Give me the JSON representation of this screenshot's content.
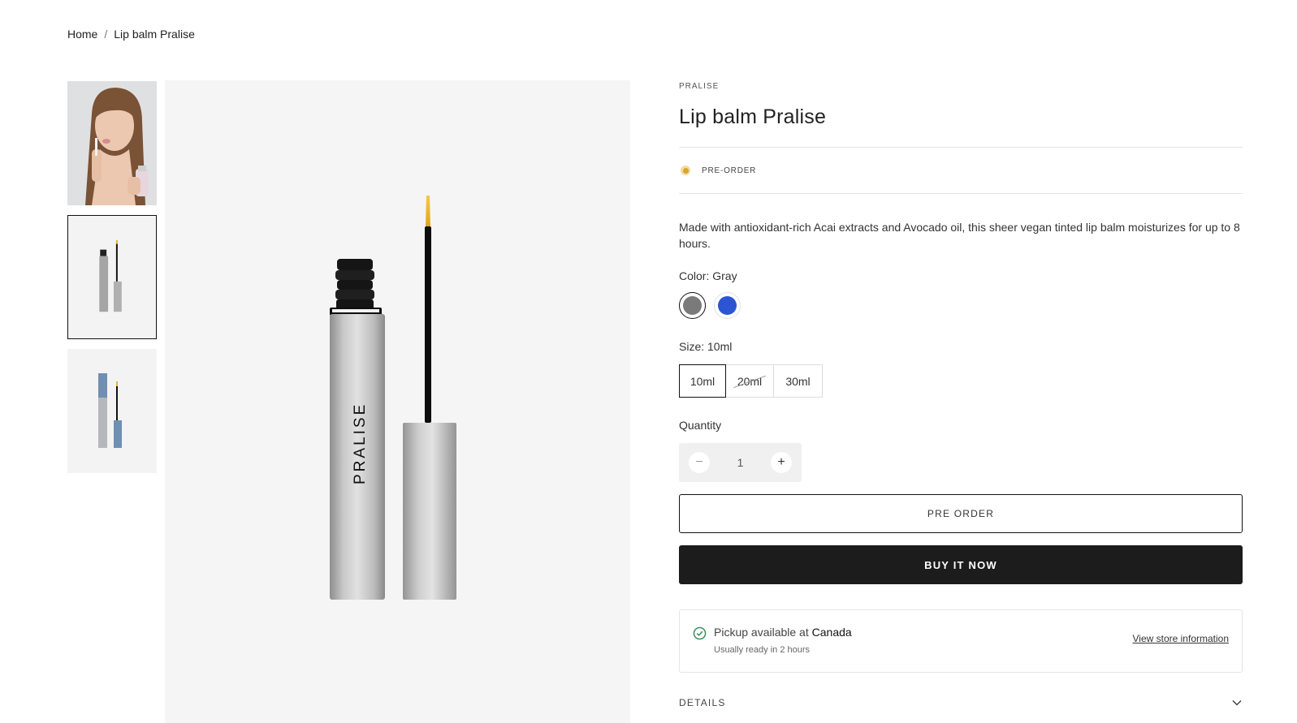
{
  "breadcrumb": {
    "home": "Home",
    "separator": "/",
    "current": "Lip balm Pralise"
  },
  "product": {
    "vendor": "PRALISE",
    "title": "Lip balm Pralise",
    "status": "PRE-ORDER",
    "description": "Made with antioxidant-rich Acai extracts and Avocado oil, this sheer vegan tinted lip balm moisturizes for up to 8 hours.",
    "image_brand_text": "PRALISE"
  },
  "color": {
    "label": "Color: Gray",
    "options": [
      {
        "name": "Gray",
        "hex": "#7a7a7a",
        "selected": true
      },
      {
        "name": "Blue",
        "hex": "#2c55d3",
        "selected": false
      }
    ]
  },
  "size": {
    "label": "Size: 10ml",
    "options": [
      {
        "label": "10ml",
        "selected": true,
        "available": true
      },
      {
        "label": "20ml",
        "selected": false,
        "available": false
      },
      {
        "label": "30ml",
        "selected": false,
        "available": true
      }
    ]
  },
  "quantity": {
    "label": "Quantity",
    "value": "1",
    "minus": "−",
    "plus": "+"
  },
  "buttons": {
    "pre_order": "PRE ORDER",
    "buy_now": "BUY IT NOW"
  },
  "pickup": {
    "text": "Pickup available at",
    "location": "Canada",
    "sub": "Usually ready in 2 hours",
    "link": "View store information"
  },
  "details": {
    "label": "DETAILS"
  },
  "colors": {
    "preorder_dot": "#d9a52a",
    "accent_dark": "#1c1c1c",
    "check_green": "#2e8b57"
  }
}
